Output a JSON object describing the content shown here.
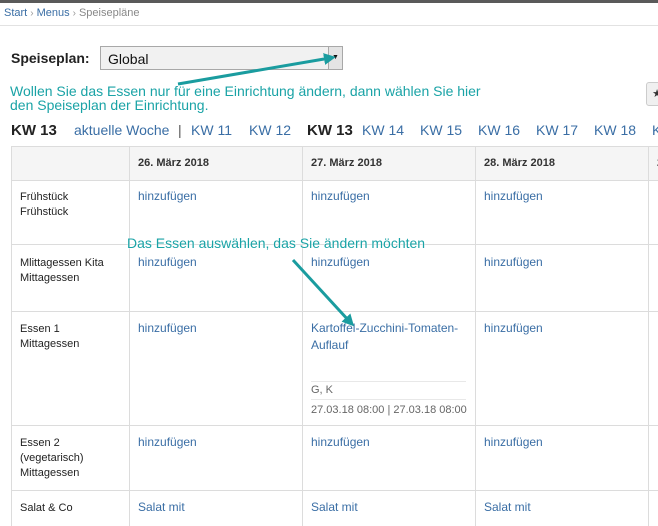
{
  "breadcrumb": {
    "start": "Start",
    "menus": "Menus",
    "current": "Speisepläne"
  },
  "plan": {
    "label": "Speiseplan:",
    "selected": "Global"
  },
  "notes": {
    "change_plan_line1": "Wollen Sie das Essen nur für eine Einrichtung ändern, dann wählen Sie hier",
    "change_plan_line2": "den Speiseplan der Einrichtung.",
    "choose_meal": "Das Essen auswählen, das Sie ändern möchten"
  },
  "toolbar": {
    "star_icon": "★"
  },
  "week_nav": {
    "current": "KW 13",
    "current_week_link": "aktuelle Woche",
    "separator": "|",
    "weeks": [
      "KW 11",
      "KW 12",
      "KW 13",
      "KW 14",
      "KW 15",
      "KW 16",
      "KW 17",
      "KW 18",
      "K"
    ]
  },
  "table": {
    "columns": [
      "26. März 2018",
      "27. März 2018",
      "28. März 2018",
      "2"
    ],
    "rows": [
      {
        "label_lines": [
          "Frühstück",
          "Frühstück"
        ],
        "cells": [
          "hinzufügen",
          "hinzufügen",
          "hinzufügen"
        ]
      },
      {
        "label_lines": [
          "Mlittagessen Kita",
          "Mittagessen"
        ],
        "cells": [
          "hinzufügen",
          "hinzufügen",
          "hinzufügen"
        ]
      },
      {
        "label_lines": [
          "Essen 1",
          "Mittagessen"
        ],
        "cells": [
          "hinzufügen",
          "",
          "hinzufügen"
        ]
      },
      {
        "label_lines": [
          "Essen 2",
          "(vegetarisch)",
          "Mittagessen"
        ],
        "cells": [
          "hinzufügen",
          "hinzufügen",
          "hinzufügen"
        ]
      },
      {
        "label_lines": [
          "Salat & Co"
        ],
        "cells": [
          "Salat mit",
          "Salat mit",
          "Salat mit"
        ]
      }
    ],
    "meal": {
      "title_line1": "Kartoffel-Zucchini-Tomaten-",
      "title_line2": "Auflauf",
      "tags": "G, K",
      "time": "27.03.18 08:00 | 27.03.18 08:00"
    }
  },
  "colors": {
    "accent": "#3a6ea5",
    "annotation": "#1aa3a6"
  }
}
